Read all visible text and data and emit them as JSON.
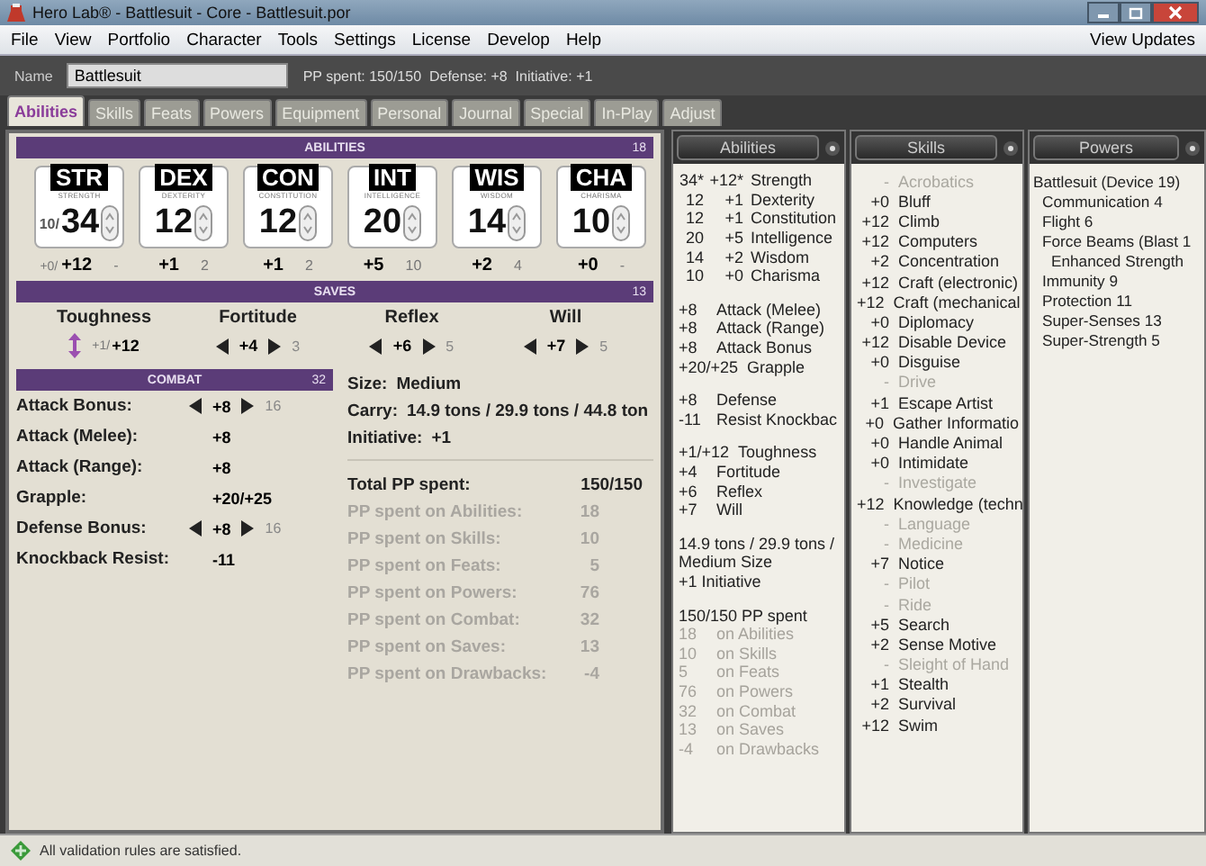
{
  "window": {
    "title": "Hero Lab® - Battlesuit - Core - Battlesuit.por"
  },
  "menu": [
    "File",
    "View",
    "Portfolio",
    "Character",
    "Tools",
    "Settings",
    "License",
    "Develop",
    "Help"
  ],
  "menu_right": "View Updates",
  "name_bar": {
    "label": "Name",
    "value": "Battlesuit",
    "summary": "PP spent: 150/150  Defense: +8  Initiative: +1"
  },
  "tabs": [
    {
      "label": "Abilities",
      "selected": true
    },
    {
      "label": "Skills",
      "selected": false
    },
    {
      "label": "Feats",
      "selected": false
    },
    {
      "label": "Powers",
      "selected": false
    },
    {
      "label": "Equipment",
      "selected": false
    },
    {
      "label": "Personal",
      "selected": false
    },
    {
      "label": "Journal",
      "selected": false
    },
    {
      "label": "Special",
      "selected": false
    },
    {
      "label": "In-Play",
      "selected": false
    },
    {
      "label": "Adjust",
      "selected": false
    }
  ],
  "abilities_panel": {
    "title": "ABILITIES",
    "count": "18",
    "items": [
      {
        "abbr": "STR",
        "name": "STRENGTH",
        "prefix": "10/",
        "value": "34",
        "mod_prefix": "+0/",
        "mod": "+12",
        "cost": "-"
      },
      {
        "abbr": "DEX",
        "name": "DEXTERITY",
        "value": "12",
        "mod": "+1",
        "cost": "2"
      },
      {
        "abbr": "CON",
        "name": "CONSTITUTION",
        "value": "12",
        "mod": "+1",
        "cost": "2"
      },
      {
        "abbr": "INT",
        "name": "INTELLIGENCE",
        "value": "20",
        "mod": "+5",
        "cost": "10"
      },
      {
        "abbr": "WIS",
        "name": "WISDOM",
        "value": "14",
        "mod": "+2",
        "cost": "4"
      },
      {
        "abbr": "CHA",
        "name": "CHARISMA",
        "value": "10",
        "mod": "+0",
        "cost": "-"
      }
    ]
  },
  "saves_panel": {
    "title": "SAVES",
    "count": "13",
    "items": [
      {
        "label": "Toughness",
        "kind": "fixed",
        "prefix": "+1/",
        "value": "+12"
      },
      {
        "label": "Fortitude",
        "kind": "adjustable",
        "value": "+4",
        "cost": "3"
      },
      {
        "label": "Reflex",
        "kind": "adjustable",
        "value": "+6",
        "cost": "5"
      },
      {
        "label": "Will",
        "kind": "adjustable",
        "value": "+7",
        "cost": "5"
      }
    ]
  },
  "combat_panel": {
    "title": "COMBAT",
    "count": "32",
    "rows": [
      {
        "label": "Attack Bonus:",
        "kind": "adjustable",
        "value": "+8",
        "cost": "16"
      },
      {
        "label": "Attack (Melee):",
        "kind": "fixed",
        "value": "+8"
      },
      {
        "label": "Attack (Range):",
        "kind": "fixed",
        "value": "+8"
      },
      {
        "label": "Grapple:",
        "kind": "fixed",
        "value": "+20/+25"
      },
      {
        "label": "Defense Bonus:",
        "kind": "adjustable",
        "value": "+8",
        "cost": "16"
      },
      {
        "label": "Knockback Resist:",
        "kind": "fixed",
        "value": "-11"
      }
    ]
  },
  "stats": [
    {
      "label": "Size:",
      "value": "Medium"
    },
    {
      "label": "Carry:",
      "value": "14.9 tons / 29.9 tons / 44.8 ton"
    },
    {
      "label": "Initiative:",
      "value": "+1"
    }
  ],
  "pp_total": {
    "label": "Total PP spent:",
    "value": "150/150"
  },
  "pp_rows": [
    {
      "label": "PP spent on Abilities:",
      "value": "18"
    },
    {
      "label": "PP spent on Skills:",
      "value": "10"
    },
    {
      "label": "PP spent on Feats:",
      "value": "5"
    },
    {
      "label": "PP spent on Powers:",
      "value": "76"
    },
    {
      "label": "PP spent on Combat:",
      "value": "32"
    },
    {
      "label": "PP spent on Saves:",
      "value": "13"
    },
    {
      "label": "PP spent on Drawbacks:",
      "value": "-4"
    }
  ],
  "abilities_column": {
    "title": "Abilities",
    "groups": [
      [
        {
          "cells": [
            "34*",
            "+12*",
            "Strength"
          ],
          "dim": false
        },
        {
          "cells": [
            "12",
            "+1",
            "Dexterity"
          ],
          "dim": false
        },
        {
          "cells": [
            "12",
            "+1",
            "Constitution"
          ],
          "dim": false
        },
        {
          "cells": [
            "20",
            "+5",
            "Intelligence"
          ],
          "dim": false
        },
        {
          "cells": [
            "14",
            "+2",
            "Wisdom"
          ],
          "dim": false
        },
        {
          "cells": [
            "10",
            "+0",
            "Charisma"
          ],
          "dim": false
        }
      ],
      [
        {
          "cells": [
            "+8",
            "Attack (Melee)"
          ],
          "dim": false
        },
        {
          "cells": [
            "+8",
            "Attack (Range)"
          ],
          "dim": false
        },
        {
          "cells": [
            "+8",
            "Attack Bonus"
          ],
          "dim": false
        },
        {
          "cells": [
            "+20/+25",
            "Grapple"
          ],
          "dim": false
        }
      ],
      [
        {
          "cells": [
            "+8",
            "Defense"
          ],
          "dim": false
        },
        {
          "cells": [
            "-11",
            "Resist Knockbac"
          ],
          "dim": false
        }
      ],
      [
        {
          "cells": [
            "+1/+12",
            "Toughness"
          ],
          "dim": false
        },
        {
          "cells": [
            "+4",
            "Fortitude"
          ],
          "dim": false
        },
        {
          "cells": [
            "+6",
            "Reflex"
          ],
          "dim": false
        },
        {
          "cells": [
            "+7",
            "Will"
          ],
          "dim": false
        }
      ],
      [
        {
          "cells": [
            "14.9 tons / 29.9 tons /"
          ],
          "dim": false
        },
        {
          "cells": [
            "Medium Size"
          ],
          "dim": false
        },
        {
          "cells": [
            "+1 Initiative"
          ],
          "dim": false
        }
      ],
      [
        {
          "cells": [
            "150/150 PP spent"
          ],
          "dim": false
        },
        {
          "cells": [
            "18",
            "on Abilities"
          ],
          "dim": true
        },
        {
          "cells": [
            "10",
            "on Skills"
          ],
          "dim": true
        },
        {
          "cells": [
            "5",
            "on Feats"
          ],
          "dim": true
        },
        {
          "cells": [
            "76",
            "on Powers"
          ],
          "dim": true
        },
        {
          "cells": [
            "32",
            "on Combat"
          ],
          "dim": true
        },
        {
          "cells": [
            "13",
            "on Saves"
          ],
          "dim": true
        },
        {
          "cells": [
            "-4",
            "on Drawbacks"
          ],
          "dim": true
        }
      ]
    ]
  },
  "skills_column": {
    "title": "Skills",
    "skills": [
      {
        "value": "-",
        "name": "Acrobatics",
        "trained": false
      },
      {
        "value": "+0",
        "name": "Bluff",
        "trained": true
      },
      {
        "value": "+12",
        "name": "Climb",
        "trained": true
      },
      {
        "value": "+12",
        "name": "Computers",
        "trained": true
      },
      {
        "value": "+2",
        "name": "Concentration",
        "trained": true
      },
      {
        "value": "+12",
        "name": "Craft (electronic)",
        "trained": true
      },
      {
        "value": "+12",
        "name": "Craft (mechanical",
        "trained": true
      },
      {
        "value": "+0",
        "name": "Diplomacy",
        "trained": true
      },
      {
        "value": "+12",
        "name": "Disable Device",
        "trained": true
      },
      {
        "value": "+0",
        "name": "Disguise",
        "trained": true
      },
      {
        "value": "-",
        "name": "Drive",
        "trained": false
      },
      {
        "value": "+1",
        "name": "Escape Artist",
        "trained": true
      },
      {
        "value": "+0",
        "name": "Gather Informatio",
        "trained": true
      },
      {
        "value": "+0",
        "name": "Handle Animal",
        "trained": true
      },
      {
        "value": "+0",
        "name": "Intimidate",
        "trained": true
      },
      {
        "value": "-",
        "name": "Investigate",
        "trained": false
      },
      {
        "value": "+12",
        "name": "Knowledge (techn",
        "trained": true
      },
      {
        "value": "-",
        "name": "Language",
        "trained": false
      },
      {
        "value": "-",
        "name": "Medicine",
        "trained": false
      },
      {
        "value": "+7",
        "name": "Notice",
        "trained": true
      },
      {
        "value": "-",
        "name": "Pilot",
        "trained": false
      },
      {
        "value": "-",
        "name": "Ride",
        "trained": false
      },
      {
        "value": "+5",
        "name": "Search",
        "trained": true
      },
      {
        "value": "+2",
        "name": "Sense Motive",
        "trained": true
      },
      {
        "value": "-",
        "name": "Sleight of Hand",
        "trained": false
      },
      {
        "value": "+1",
        "name": "Stealth",
        "trained": true
      },
      {
        "value": "+2",
        "name": "Survival",
        "trained": true
      },
      {
        "value": "+12",
        "name": "Swim",
        "trained": true
      }
    ]
  },
  "powers_column": {
    "title": "Powers",
    "powers": [
      {
        "name": "Battlesuit (Device 19)",
        "children": [
          {
            "name": "Communication 4"
          },
          {
            "name": "Flight 6"
          },
          {
            "name": "Force Beams (Blast 1",
            "children": [
              {
                "name": "Enhanced Strength"
              }
            ]
          },
          {
            "name": "Immunity 9"
          },
          {
            "name": "Protection 11"
          },
          {
            "name": "Super-Senses 13"
          },
          {
            "name": "Super-Strength 5"
          }
        ]
      }
    ]
  },
  "status_bar": {
    "message": "All validation rules are satisfied."
  }
}
